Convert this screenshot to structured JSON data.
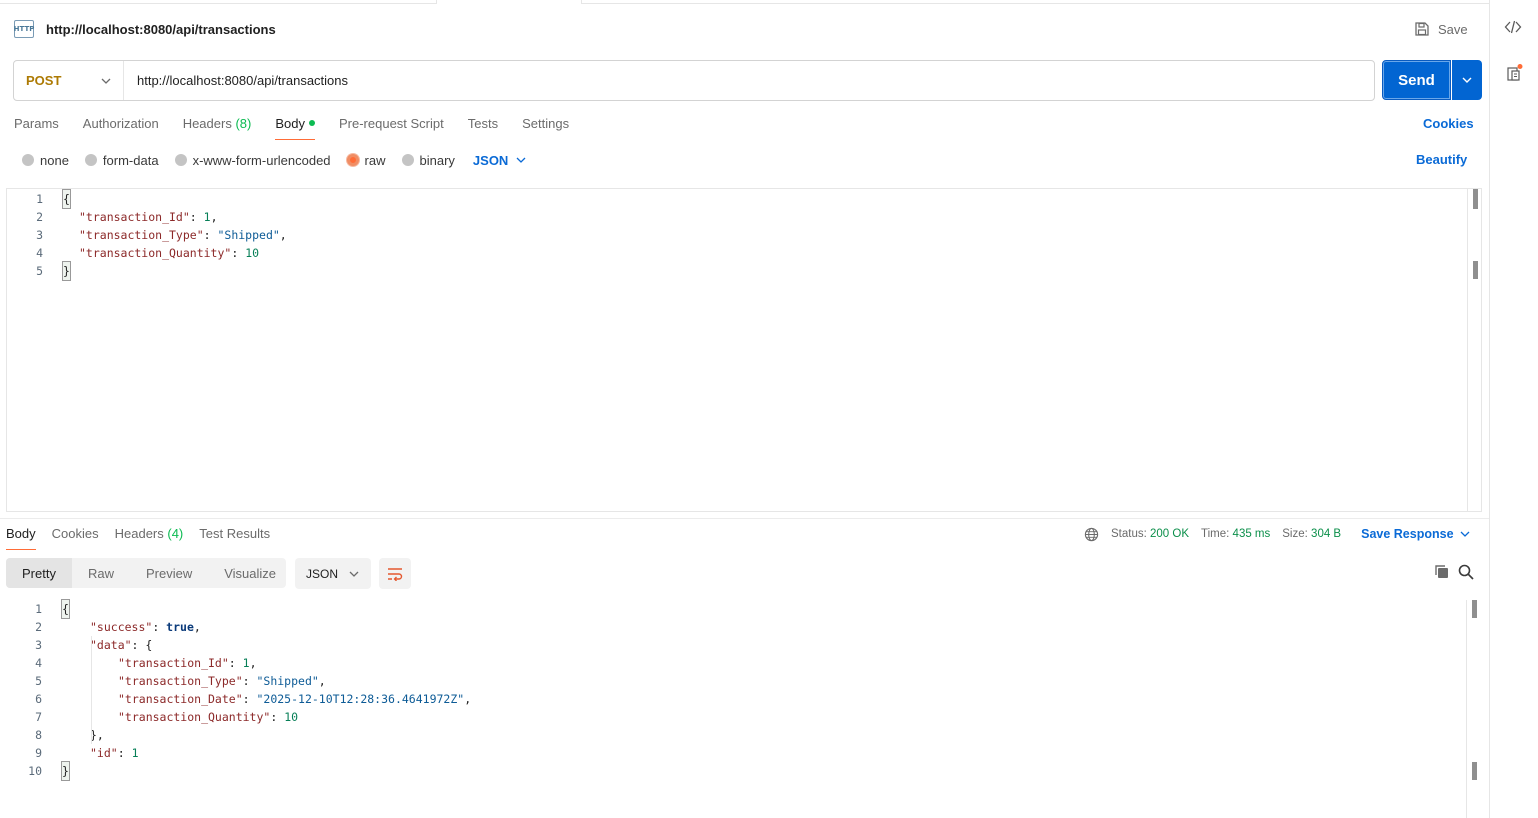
{
  "request": {
    "title": "http://localhost:8080/api/transactions",
    "method": "POST",
    "url": "http://localhost:8080/api/transactions",
    "save_label": "Save",
    "send_label": "Send",
    "http_badge": "HTTP",
    "tabs": [
      {
        "label": "Params"
      },
      {
        "label": "Authorization"
      },
      {
        "label": "Headers",
        "count": "(8)"
      },
      {
        "label": "Body"
      },
      {
        "label": "Pre-request Script"
      },
      {
        "label": "Tests"
      },
      {
        "label": "Settings"
      }
    ],
    "cookies_label": "Cookies",
    "body_types": [
      "none",
      "form-data",
      "x-www-form-urlencoded",
      "raw",
      "binary"
    ],
    "selected_body_type": "raw",
    "body_language": "JSON",
    "beautify_label": "Beautify",
    "body_lines": [
      "1",
      "2",
      "3",
      "4",
      "5"
    ],
    "body": {
      "open": "{",
      "k1": "\"transaction_Id\"",
      "v1": "1",
      "k2": "\"transaction_Type\"",
      "v2": "\"Shipped\"",
      "k3": "\"transaction_Quantity\"",
      "v3": "10",
      "close": "}"
    }
  },
  "response": {
    "tabs": [
      {
        "label": "Body"
      },
      {
        "label": "Cookies"
      },
      {
        "label": "Headers",
        "count": "(4)"
      },
      {
        "label": "Test Results"
      }
    ],
    "status_label": "Status:",
    "status_value": "200 OK",
    "time_label": "Time:",
    "time_value": "435 ms",
    "size_label": "Size:",
    "size_value": "304 B",
    "save_response_label": "Save Response",
    "views": [
      "Pretty",
      "Raw",
      "Preview",
      "Visualize"
    ],
    "language": "JSON",
    "line_numbers": [
      "1",
      "2",
      "3",
      "4",
      "5",
      "6",
      "7",
      "8",
      "9",
      "10"
    ],
    "body": {
      "open": "{",
      "k_success": "\"success\"",
      "v_success": "true",
      "k_data": "\"data\"",
      "k_id": "\"transaction_Id\"",
      "v_id": "1",
      "k_type": "\"transaction_Type\"",
      "v_type": "\"Shipped\"",
      "k_date": "\"transaction_Date\"",
      "v_date": "\"2025-12-10T12:28:36.4641972Z\"",
      "k_qty": "\"transaction_Quantity\"",
      "v_qty": "10",
      "k_rid": "\"id\"",
      "v_rid": "1",
      "close": "}"
    }
  },
  "colors": {
    "accent": "#0265d2",
    "method": "#ad7a03",
    "active_tab_underline": "#ff6c37",
    "status_ok": "#0b8f4a"
  },
  "icons": [
    "http-request-icon",
    "save-icon",
    "chevron-down-icon",
    "globe-icon",
    "wrap-lines-icon",
    "copy-icon",
    "search-icon",
    "code-icon",
    "documentation-icon"
  ]
}
